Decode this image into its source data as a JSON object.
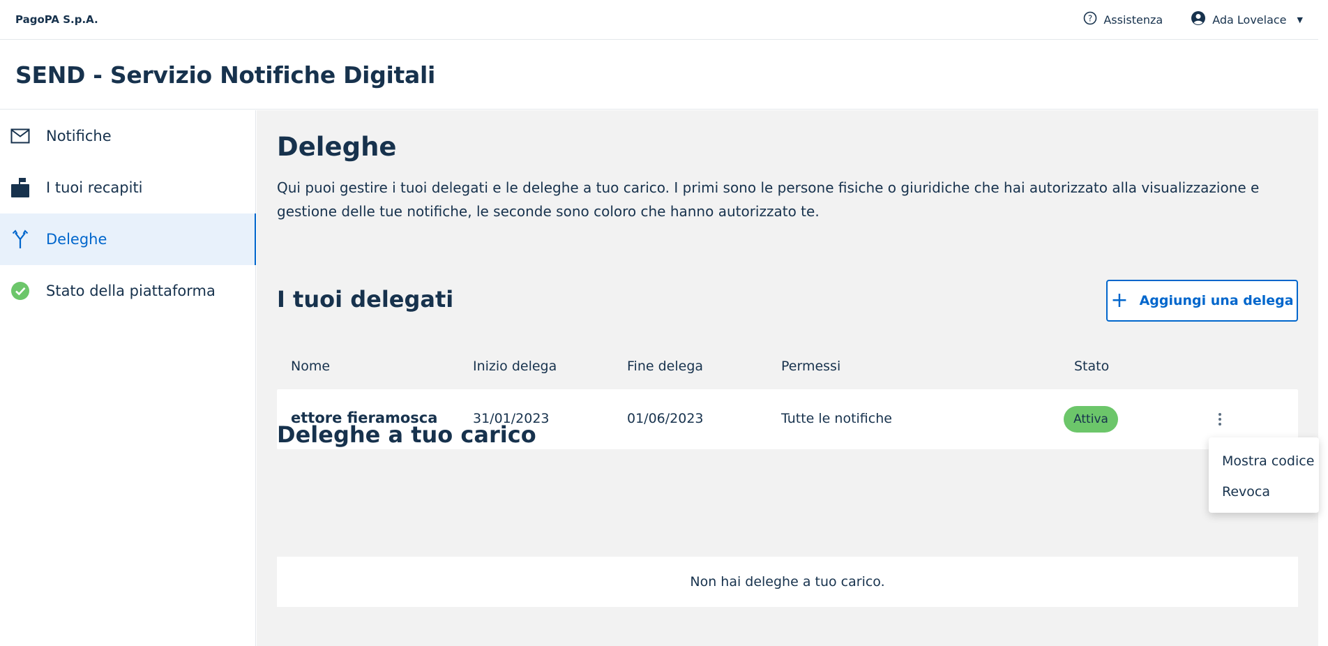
{
  "topbar": {
    "brand": "PagoPA S.p.A.",
    "help_label": "Assistenza",
    "user_name": "Ada Lovelace"
  },
  "product": {
    "title": "SEND - Servizio Notifiche Digitali"
  },
  "sidebar": {
    "items": [
      {
        "label": "Notifiche",
        "icon": "mail-icon"
      },
      {
        "label": "I tuoi recapiti",
        "icon": "mailbox-icon"
      },
      {
        "label": "Deleghe",
        "icon": "fork-icon",
        "active": true
      },
      {
        "label": "Stato della piattaforma",
        "icon": "check-circle-icon"
      }
    ]
  },
  "main": {
    "title": "Deleghe",
    "intro": "Qui puoi gestire i tuoi delegati e le deleghe a tuo carico. I primi sono le persone fisiche o giuridiche che hai autorizzato alla visualizzazione e gestione delle tue notifiche, le seconde sono coloro che hanno autorizzato te.",
    "delegates": {
      "title": "I tuoi delegati",
      "add_button": "Aggiungi una delega",
      "columns": [
        "Nome",
        "Inizio delega",
        "Fine delega",
        "Permessi",
        "Stato"
      ],
      "rows": [
        {
          "name": "ettore fieramosca",
          "start": "31/01/2023",
          "end": "01/06/2023",
          "permissions": "Tutte le notifiche",
          "status": "Attiva"
        }
      ]
    },
    "menu": {
      "items": [
        "Mostra codice",
        "Revoca"
      ]
    },
    "delegators": {
      "title": "Deleghe a tuo carico",
      "empty": "Non hai deleghe a tuo carico."
    }
  },
  "colors": {
    "primary": "#0066cc",
    "text": "#17324d",
    "active_bg": "#e8f1fb",
    "badge_green": "#6cc66a",
    "check_green": "#6cc66a",
    "main_bg": "#f2f2f2"
  }
}
